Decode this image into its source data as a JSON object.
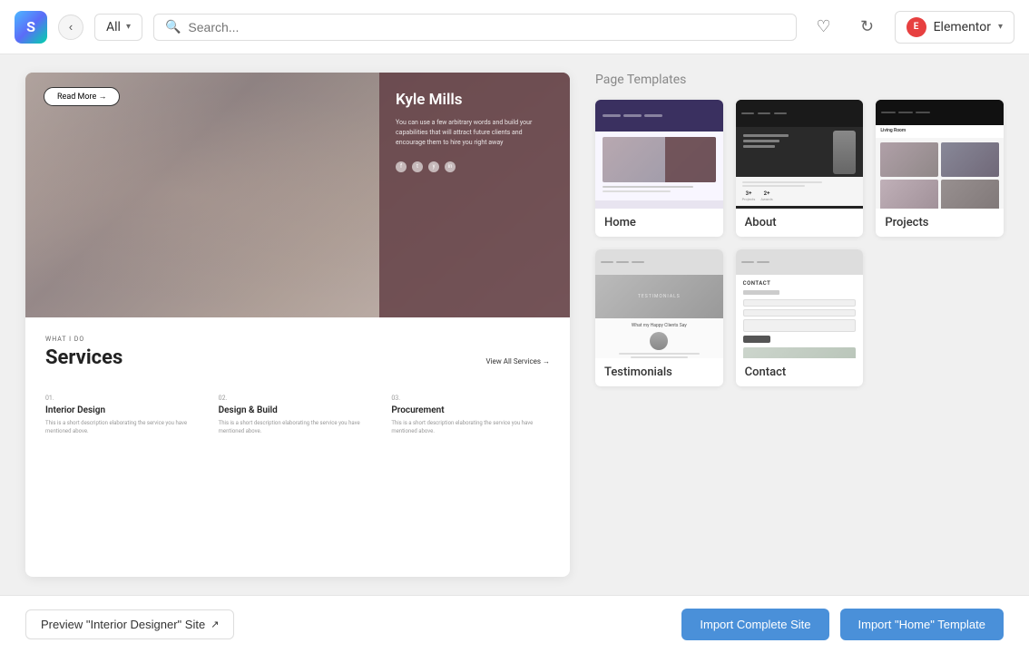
{
  "header": {
    "logo_text": "S",
    "filter_value": "All",
    "search_placeholder": "Search...",
    "elementor_label": "Elementor"
  },
  "page": {
    "title": "Interior Designer",
    "section_label": "Page Templates"
  },
  "preview": {
    "read_more": "Read More →",
    "hero_name": "Kyle Mills",
    "hero_desc": "You can use a few arbitrary words and build your capabilities that will attract future clients and encourage them to hire you right away",
    "what_i_do": "WHAT I DO",
    "services_title": "Services",
    "view_all": "View All Services →",
    "service1_num": "01.",
    "service1_title": "Interior Design",
    "service1_desc": "This is a short description elaborating the service you have mentioned above.",
    "service2_num": "02.",
    "service2_title": "Design & Build",
    "service2_desc": "This is a short description elaborating the service you have mentioned above.",
    "service3_num": "03.",
    "service3_title": "Procurement",
    "service3_desc": "This is a short description elaborating the service you have mentioned above."
  },
  "templates": [
    {
      "id": "home",
      "label": "Home"
    },
    {
      "id": "about",
      "label": "About"
    },
    {
      "id": "projects",
      "label": "Projects"
    },
    {
      "id": "testimonials",
      "label": "Testimonials"
    },
    {
      "id": "contact",
      "label": "Contact"
    }
  ],
  "footer": {
    "preview_label": "Preview \"Interior Designer\" Site",
    "import_complete_label": "Import Complete Site",
    "import_home_label": "Import \"Home\" Template"
  },
  "about_stats": [
    {
      "num": "3+",
      "label": "Projects"
    },
    {
      "num": "2+",
      "label": "Awards"
    }
  ]
}
